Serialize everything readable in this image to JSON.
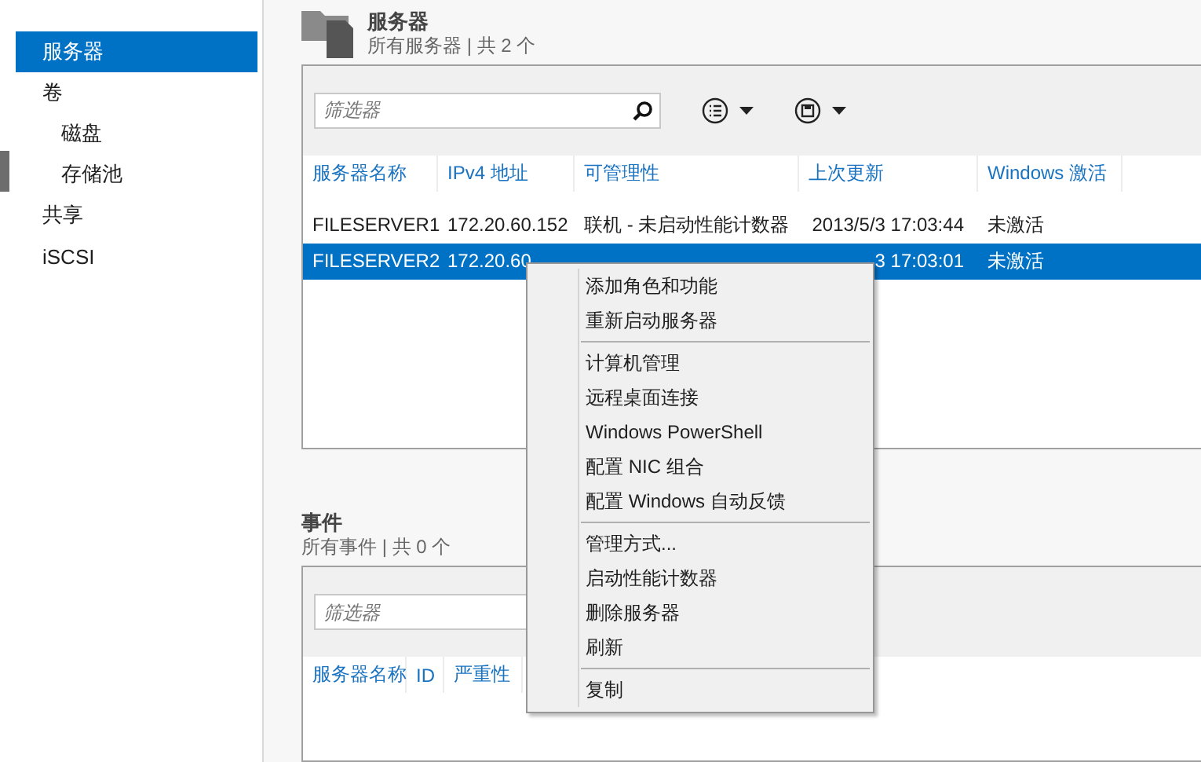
{
  "sidebar": {
    "items": [
      {
        "label": "服务器",
        "selected": true
      },
      {
        "label": "卷",
        "selected": false,
        "children": [
          {
            "label": "磁盘",
            "selected": false
          },
          {
            "label": "存储池",
            "selected": false
          }
        ]
      },
      {
        "label": "共享",
        "selected": false
      },
      {
        "label": "iSCSI",
        "selected": false
      }
    ]
  },
  "servers": {
    "title": "服务器",
    "subtitle": "所有服务器 | 共 2 个",
    "filter": {
      "placeholder": "筛选器"
    },
    "columns": [
      "服务器名称",
      "IPv4 地址",
      "可管理性",
      "上次更新",
      "Windows 激活"
    ],
    "rows": [
      {
        "cells": [
          "FILESERVER1",
          "172.20.60.152",
          "联机 - 未启动性能计数器",
          "2013/5/3 17:03:44",
          "未激活"
        ],
        "selected": false
      },
      {
        "cells": [
          "FILESERVER2",
          "172.20.60",
          null,
          "3 17:03:01",
          "未激活"
        ],
        "selected": true
      }
    ]
  },
  "events": {
    "title": "事件",
    "subtitle": "所有事件 | 共 0 个",
    "filter": {
      "placeholder": "筛选器"
    },
    "columns": [
      "服务器名称",
      "ID",
      "严重性"
    ]
  },
  "context_menu": {
    "groups": [
      [
        "添加角色和功能",
        "重新启动服务器"
      ],
      [
        "计算机管理",
        "远程桌面连接",
        "Windows PowerShell",
        "配置 NIC 组合",
        "配置 Windows 自动反馈"
      ],
      [
        "管理方式...",
        "启动性能计数器",
        "删除服务器",
        "刷新"
      ],
      [
        "复制"
      ]
    ]
  }
}
